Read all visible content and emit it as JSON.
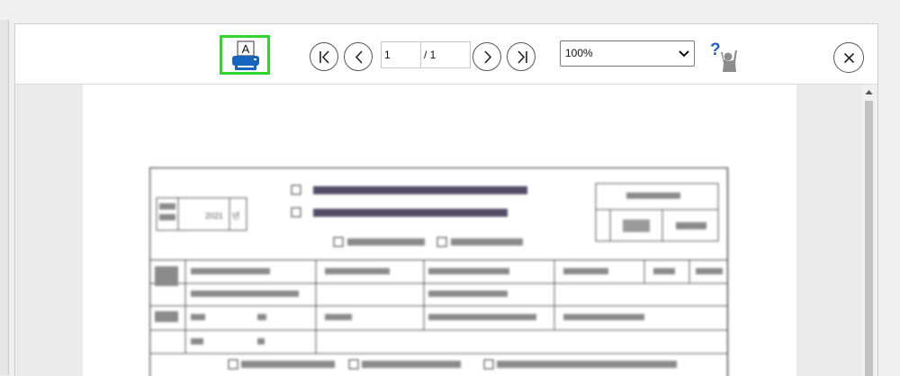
{
  "toolbar": {
    "print_icon_letter": "A",
    "page_current": "1",
    "page_total": "/ 1",
    "zoom": "100%",
    "help_glyph": "?"
  },
  "icons": {
    "print": "printer-icon",
    "first": "first-page-icon",
    "prev": "previous-page-icon",
    "next": "next-page-icon",
    "last": "last-page-icon",
    "dropdown": "chevron-down-icon",
    "help": "help-person-icon",
    "close": "close-icon"
  },
  "colors": {
    "highlight": "#2ed62e",
    "printer_blue": "#1565c0",
    "help_blue": "#1f5fbf"
  },
  "document": {
    "blurred": true,
    "year": "2021",
    "year_suffix": "년"
  }
}
